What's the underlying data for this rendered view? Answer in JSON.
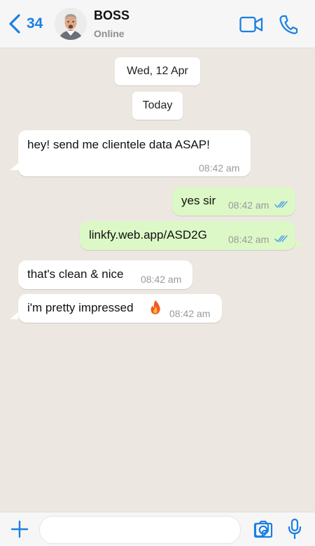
{
  "header": {
    "back_count": "34",
    "contact_name": "BOSS",
    "contact_status": "Online",
    "accent_color": "#1a7fe3"
  },
  "chat": {
    "date_label": "Wed, 12 Apr",
    "day_label": "Today",
    "messages": [
      {
        "direction": "incoming",
        "text": "hey! send me clientele data ASAP!",
        "time": "08:42 am"
      },
      {
        "direction": "outgoing",
        "text": "yes sir",
        "time": "08:42 am",
        "status": "read"
      },
      {
        "direction": "outgoing",
        "text": "linkfy.web.app/ASD2G",
        "time": "08:42 am",
        "status": "read"
      },
      {
        "direction": "incoming",
        "text": "that's clean & nice",
        "time": "08:42 am"
      },
      {
        "direction": "incoming",
        "text": "i'm pretty impressed",
        "emoji": "fire-emoji",
        "time": "08:42 am"
      }
    ],
    "incoming_bubble_color": "#ffffff",
    "outgoing_bubble_color": "#dcf8c6",
    "read_tick_color": "#4fa3e8"
  },
  "footer": {
    "message_input": {
      "value": "",
      "placeholder": ""
    },
    "icons": [
      "plus-icon",
      "sticker-icon",
      "camera-icon",
      "microphone-icon"
    ]
  }
}
